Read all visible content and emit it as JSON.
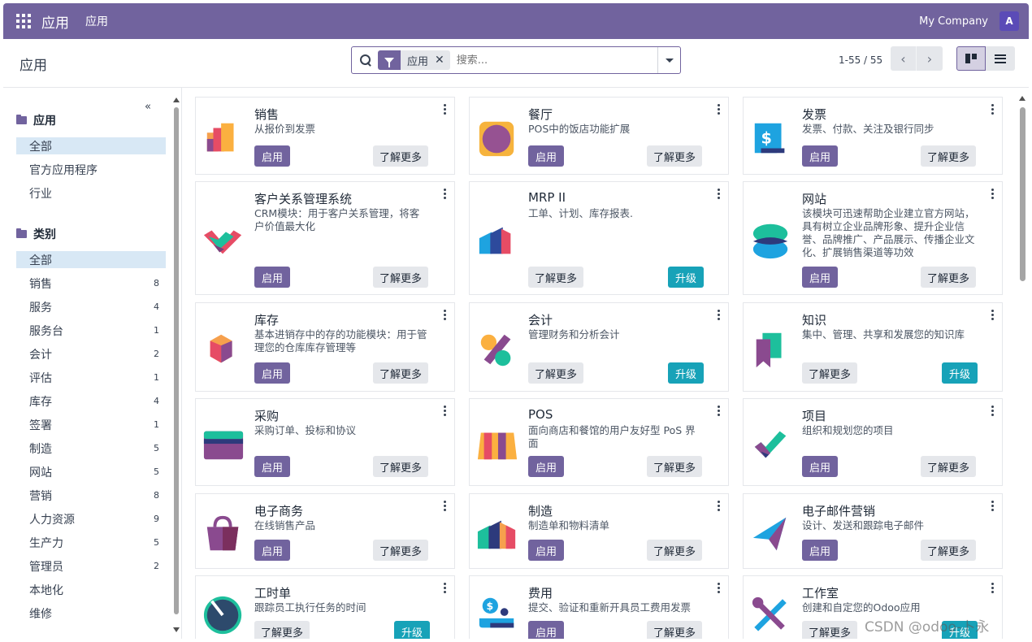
{
  "navbar": {
    "brand": "应用",
    "menu": "应用",
    "company": "My Company",
    "avatar": "A"
  },
  "control": {
    "title": "应用",
    "facet_label": "应用",
    "facet_close": "✕",
    "search_placeholder": "搜索...",
    "pager": "1-55 / 55",
    "prev": "‹",
    "next": "›"
  },
  "sidebar": {
    "collapse": "«",
    "apps_head": "应用",
    "apps_items": [
      "全部",
      "官方应用程序",
      "行业"
    ],
    "cat_head": "类别",
    "categories": [
      {
        "label": "全部",
        "count": ""
      },
      {
        "label": "销售",
        "count": "8"
      },
      {
        "label": "服务",
        "count": "4"
      },
      {
        "label": "服务台",
        "count": "1"
      },
      {
        "label": "会计",
        "count": "2"
      },
      {
        "label": "评估",
        "count": "1"
      },
      {
        "label": "库存",
        "count": "4"
      },
      {
        "label": "签署",
        "count": "1"
      },
      {
        "label": "制造",
        "count": "5"
      },
      {
        "label": "网站",
        "count": "5"
      },
      {
        "label": "营销",
        "count": "8"
      },
      {
        "label": "人力资源",
        "count": "9"
      },
      {
        "label": "生产力",
        "count": "5"
      },
      {
        "label": "管理员",
        "count": "2"
      },
      {
        "label": "本地化",
        "count": ""
      },
      {
        "label": "维修",
        "count": ""
      }
    ]
  },
  "buttons": {
    "install": "启用",
    "more": "了解更多",
    "upgrade": "升级"
  },
  "cards": [
    {
      "name": "销售",
      "desc": "从报价到发票",
      "icon": "sales-icon"
    },
    {
      "name": "餐厅",
      "desc": "POS中的饭店功能扩展",
      "icon": "restaurant-icon"
    },
    {
      "name": "发票",
      "desc": "发票、付款、关注及银行同步",
      "icon": "invoice-icon"
    },
    {
      "name": "客户关系管理系统",
      "desc": "CRM模块：用于客户关系管理，将客户价值最大化",
      "icon": "crm-icon"
    },
    {
      "name": "MRP II",
      "desc": "工单、计划、库存报表.",
      "icon": "mrp-icon"
    },
    {
      "name": "网站",
      "desc": "该模块可迅速帮助企业建立官方网站，具有树立企业品牌形象、提升企业信誉、品牌推广、产品展示、传播企业文化、扩展销售渠道等功效",
      "icon": "website-icon"
    },
    {
      "name": "库存",
      "desc": "基本进销存中的存的功能模块：用于管理您的仓库库存管理等",
      "icon": "inventory-icon"
    },
    {
      "name": "会计",
      "desc": "管理财务和分析会计",
      "icon": "accounting-icon"
    },
    {
      "name": "知识",
      "desc": "集中、管理、共享和发展您的知识库",
      "icon": "knowledge-icon"
    },
    {
      "name": "采购",
      "desc": "采购订单、投标和协议",
      "icon": "purchase-icon"
    },
    {
      "name": "POS",
      "desc": "面向商店和餐馆的用户友好型 PoS 界面",
      "icon": "pos-icon"
    },
    {
      "name": "项目",
      "desc": "组织和规划您的项目",
      "icon": "project-icon"
    },
    {
      "name": "电子商务",
      "desc": "在线销售产品",
      "icon": "ecommerce-icon"
    },
    {
      "name": "制造",
      "desc": "制造单和物料清单",
      "icon": "manufacturing-icon"
    },
    {
      "name": "电子邮件营销",
      "desc": "设计、发送和跟踪电子邮件",
      "icon": "email-marketing-icon"
    },
    {
      "name": "工时单",
      "desc": "跟踪员工执行任务的时间",
      "icon": "timesheet-icon"
    },
    {
      "name": "费用",
      "desc": "提交、验证和重新开具员工费用发票",
      "icon": "expenses-icon"
    },
    {
      "name": "工作室",
      "desc": "创建和自定您的Odoo应用",
      "icon": "studio-icon"
    }
  ],
  "watermark": "CSDN @odoo-卜永",
  "colors": {
    "navbar": "#71639e",
    "install": "#71639e",
    "upgrade": "#17a2b8",
    "active_filter": "#d8e8f5"
  }
}
